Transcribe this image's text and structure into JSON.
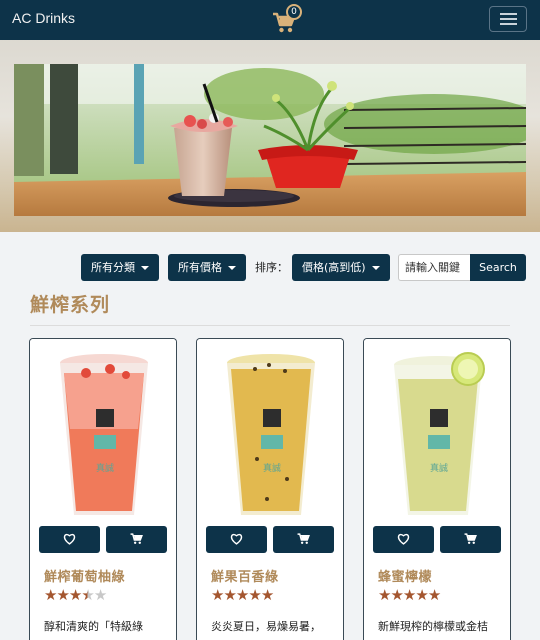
{
  "navbar": {
    "brand": "AC Drinks",
    "cart_count": "0",
    "cart_icon": "cart-icon",
    "menu_icon": "hamburger-icon"
  },
  "filters": {
    "category": "所有分類",
    "price": "所有價格",
    "sort_label": "排序：",
    "sort_value": "價格(高到低)",
    "search_placeholder": "請輸入關鍵",
    "search_button": "Search"
  },
  "section": {
    "title": "鮮榨系列"
  },
  "products": [
    {
      "name": "鮮榨葡萄柚綠",
      "rating": 3.5,
      "stars": [
        "★",
        "★",
        "★",
        "★",
        "★"
      ],
      "desc": "醇和清爽的「特級綠",
      "drink_color": "#f07a5a"
    },
    {
      "name": "鮮果百香綠",
      "rating": 5,
      "stars": [
        "★",
        "★",
        "★",
        "★",
        "★"
      ],
      "desc": "炎炎夏日，易燥易暑，",
      "drink_color": "#e2b94f"
    },
    {
      "name": "蜂蜜檸檬",
      "rating": 5,
      "stars": [
        "★",
        "★",
        "★",
        "★",
        "★"
      ],
      "desc": "新鮮現榨的檸檬或金桔",
      "drink_color": "#d8da8e"
    }
  ],
  "colors": {
    "primary": "#0d3349",
    "accent": "#b08a5a",
    "star": "#a4562f"
  }
}
